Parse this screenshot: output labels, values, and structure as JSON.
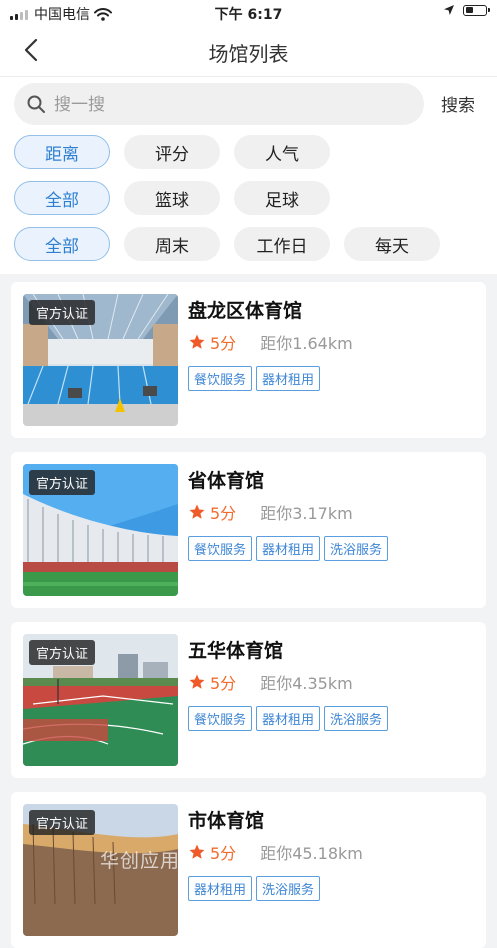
{
  "status_bar": {
    "carrier": "中国电信",
    "time": "下午 6:17",
    "signal_bars": 2,
    "battery_level": 0.4
  },
  "header": {
    "title": "场馆列表"
  },
  "search": {
    "placeholder": "搜一搜",
    "value": "",
    "button_label": "搜索"
  },
  "filter_rows": [
    [
      {
        "label": "距离",
        "active": true
      },
      {
        "label": "评分",
        "active": false
      },
      {
        "label": "人气",
        "active": false
      }
    ],
    [
      {
        "label": "全部",
        "active": true
      },
      {
        "label": "篮球",
        "active": false
      },
      {
        "label": "足球",
        "active": false
      }
    ],
    [
      {
        "label": "全部",
        "active": true
      },
      {
        "label": "周末",
        "active": false
      },
      {
        "label": "工作日",
        "active": false
      },
      {
        "label": "每天",
        "active": false
      }
    ]
  ],
  "venues": [
    {
      "badge": "官方认证",
      "name": "盘龙区体育馆",
      "score": "5分",
      "distance": "距你1.64km",
      "tags": [
        "餐饮服务",
        "器材租用"
      ],
      "image": "indoor-swimming-pool"
    },
    {
      "badge": "官方认证",
      "name": "省体育馆",
      "score": "5分",
      "distance": "距你3.17km",
      "tags": [
        "餐饮服务",
        "器材租用",
        "洗浴服务"
      ],
      "image": "stadium"
    },
    {
      "badge": "官方认证",
      "name": "五华体育馆",
      "score": "5分",
      "distance": "距你4.35km",
      "tags": [
        "餐饮服务",
        "器材租用",
        "洗浴服务"
      ],
      "image": "outdoor-courts"
    },
    {
      "badge": "官方认证",
      "name": "市体育馆",
      "score": "5分",
      "distance": "距你45.18km",
      "tags": [
        "器材租用",
        "洗浴服务"
      ],
      "image": "stadium-roof"
    }
  ],
  "watermark": "华创应用",
  "colors": {
    "accent": "#2f7fd1",
    "score": "#f36b2c",
    "star": "#f05a28",
    "tag_border": "#5a9ee0"
  }
}
